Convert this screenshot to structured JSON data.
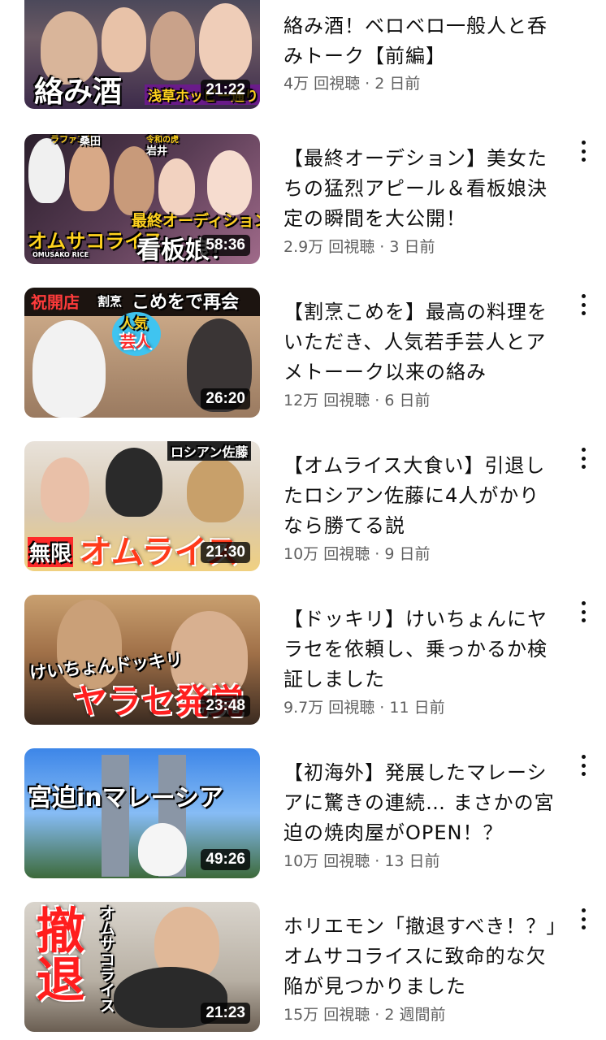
{
  "videos": [
    {
      "title": "絡み酒！ベロベロ一般人と呑みトーク【前編】",
      "meta": "4万 回視聴 · 2 日前",
      "duration": "21:22",
      "thumb_text": [
        "絡み酒",
        "浅草ホッピー通り"
      ]
    },
    {
      "title": "【最終オーデション】美女たちの猛烈アピール＆看板娘決定の瞬間を大公開！",
      "meta": "2.9万 回視聴 · 3 日前",
      "duration": "58:36",
      "thumb_text": [
        "最終オーディション",
        "看板娘！",
        "オムサコライス",
        "OMUSAKO RICE",
        "桑田",
        "岩井",
        "ラファエル",
        "令和の虎"
      ]
    },
    {
      "title": "【割烹こめを】最高の料理をいただき、人気若手芸人とアメトーーク以来の絡み",
      "meta": "12万 回視聴 · 6 日前",
      "duration": "26:20",
      "thumb_text": [
        "祝開店",
        "割烹",
        "こめをで再会",
        "人気",
        "芸人"
      ]
    },
    {
      "title": "【オムライス大食い】引退したロシアン佐藤に4人がかりなら勝てる説",
      "meta": "10万 回視聴 · 9 日前",
      "duration": "21:30",
      "thumb_text": [
        "ロシアン佐藤",
        "無限",
        "オムライス"
      ]
    },
    {
      "title": "【ドッキリ】けいちょんにヤラセを依頼し、乗っかるか検証しました",
      "meta": "9.7万 回視聴 · 11 日前",
      "duration": "23:48",
      "thumb_text": [
        "けいちょんドッキリ",
        "ヤラセ発覚"
      ]
    },
    {
      "title": "【初海外】発展したマレーシアに驚きの連続… まさかの宮迫の焼肉屋がOPEN！？",
      "meta": "10万 回視聴 · 13 日前",
      "duration": "49:26",
      "thumb_text": [
        "宮迫inマレーシア"
      ]
    },
    {
      "title": "ホリエモン「撤退すべき！？」オムサコライスに致命的な欠陥が見つかりました",
      "meta": "15万 回視聴 · 2 週間前",
      "duration": "21:23",
      "thumb_text": [
        "撤退",
        "オムサコライス"
      ]
    }
  ],
  "colors": {
    "meta": "#606060",
    "title": "#0f0f0f",
    "duration_bg": "#000000"
  },
  "icons": {
    "more": "more-vert-icon"
  }
}
